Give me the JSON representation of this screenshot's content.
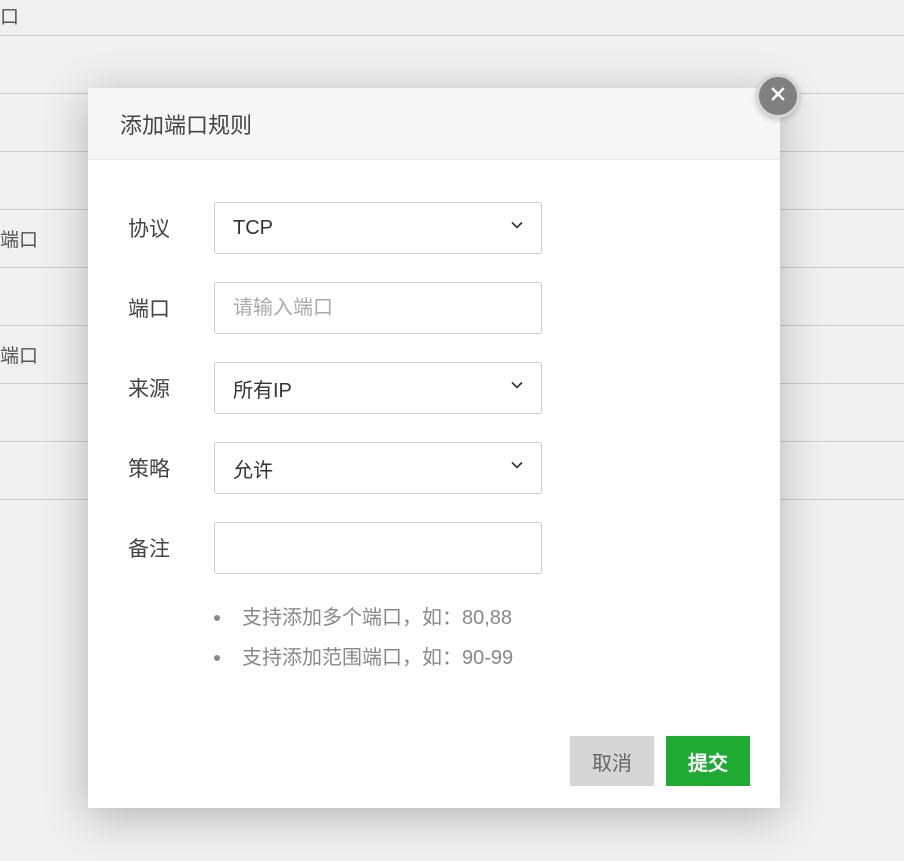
{
  "background": {
    "header_fragment": "口",
    "rows": [
      "",
      "",
      "",
      "端口",
      "",
      "端口",
      "",
      ""
    ]
  },
  "modal": {
    "title": "添加端口规则",
    "fields": {
      "protocol": {
        "label": "协议",
        "value": "TCP"
      },
      "port": {
        "label": "端口",
        "placeholder": "请输入端口",
        "value": ""
      },
      "source": {
        "label": "来源",
        "value": "所有IP"
      },
      "policy": {
        "label": "策略",
        "value": "允许"
      },
      "remark": {
        "label": "备注",
        "value": ""
      }
    },
    "hints": [
      "支持添加多个端口，如：80,88",
      "支持添加范围端口，如：90-99"
    ],
    "buttons": {
      "cancel": "取消",
      "submit": "提交"
    }
  }
}
